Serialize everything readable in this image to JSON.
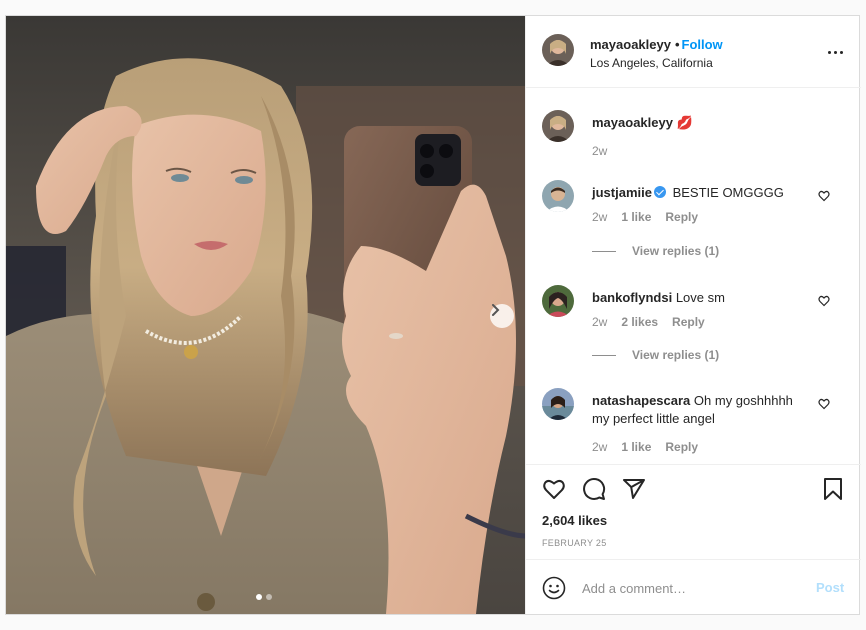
{
  "header": {
    "username": "mayaoakleyy",
    "separator": "•",
    "follow_label": "Follow",
    "location": "Los Angeles, California"
  },
  "caption": {
    "username": "mayaoakleyy",
    "text": "💋",
    "time": "2w"
  },
  "comments": [
    {
      "username": "justjamiie",
      "verified": true,
      "text": "BESTIE OMGGGG",
      "time": "2w",
      "likes": "1 like",
      "reply_label": "Reply",
      "view_replies": "View replies (1)"
    },
    {
      "username": "bankoflyndsi",
      "verified": false,
      "text": "Love sm",
      "time": "2w",
      "likes": "2 likes",
      "reply_label": "Reply",
      "view_replies": "View replies (1)"
    },
    {
      "username": "natashapescara",
      "verified": false,
      "text": "Oh my goshhhhh my perfect little angel",
      "time": "2w",
      "likes": "1 like",
      "reply_label": "Reply"
    }
  ],
  "actions": {
    "icons": [
      "heart-icon",
      "comment-icon",
      "share-icon",
      "bookmark-icon"
    ],
    "likes": "2,604 likes",
    "date": "FEBRUARY 25"
  },
  "add_comment": {
    "placeholder": "Add a comment…",
    "post_label": "Post"
  },
  "carousel": {
    "current": 1,
    "total": 2
  },
  "colors": {
    "accent": "#0095f6",
    "muted": "#8e8e8e",
    "post_disabled": "#b2dffc",
    "verified": "#3897f0"
  }
}
